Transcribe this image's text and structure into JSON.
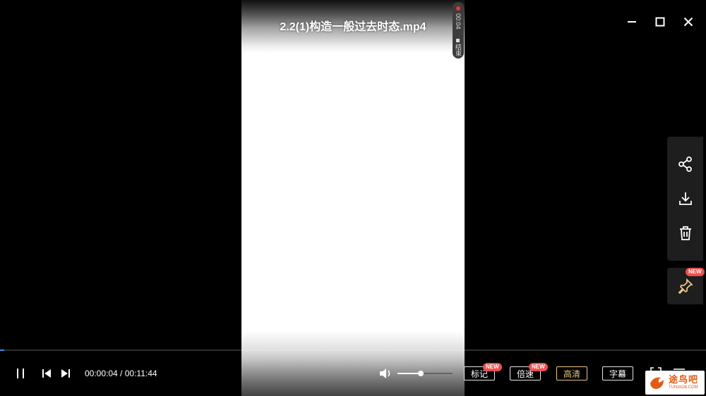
{
  "window": {
    "title": "2.2(1)构造一般过去时态.mp4",
    "minimize_icon": "minimize-icon",
    "maximize_icon": "maximize-icon",
    "close_icon": "close-icon"
  },
  "recording": {
    "time": "00:04",
    "end_label": "结束"
  },
  "side_panel": {
    "items": [
      {
        "name": "share",
        "icon": "share-icon"
      },
      {
        "name": "download",
        "icon": "download-icon"
      },
      {
        "name": "delete",
        "icon": "trash-icon"
      }
    ],
    "pin": {
      "icon": "pin-icon",
      "badge": "NEW"
    }
  },
  "playback": {
    "current_time": "00:00:04",
    "separator": " / ",
    "total_time": "00:11:44",
    "progress_fraction": 0.006,
    "volume_fraction": 0.42
  },
  "controls": {
    "mark_label": "标记",
    "mark_badge": "NEW",
    "speed_label": "倍速",
    "speed_badge": "NEW",
    "quality_label": "高清",
    "subtitle_label": "字幕"
  },
  "watermark": {
    "main": "途鸟吧",
    "sub": "TUNIAO8.COM"
  },
  "colors": {
    "accent_progress": "#3a8ee6",
    "quality_active": "#e8c583",
    "badge": "#f04e4e",
    "pin_icon": "#e8c583"
  }
}
